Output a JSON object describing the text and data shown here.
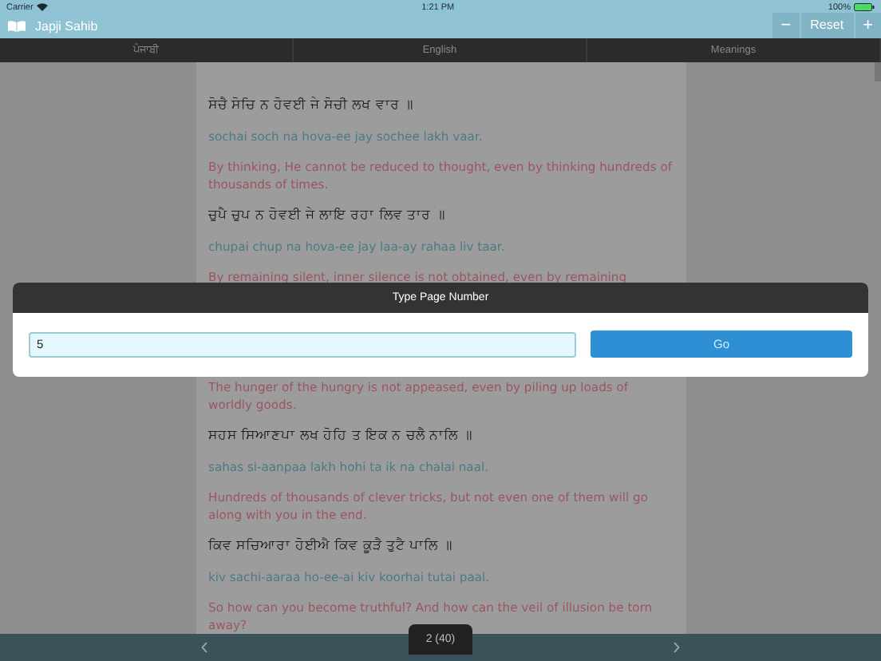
{
  "status_bar": {
    "carrier": "Carrier",
    "time": "1:21 PM",
    "battery": "100%"
  },
  "title_bar": {
    "title": "Japji Sahib",
    "buttons": [
      "−",
      "Reset",
      "+"
    ]
  },
  "tabs": [
    {
      "label": "ਪੰਜਾਬੀ",
      "selected": false
    },
    {
      "label": "English",
      "selected": false
    },
    {
      "label": "Meanings",
      "selected": false
    }
  ],
  "content_top": [
    {
      "kind": "gurmukhi",
      "text": "ਸੋਚੈ ਸੋਚਿ ਨ ਹੋਵਈ ਜੇ ਸੋਚੀ ਲਖ ਵਾਰ ॥"
    },
    {
      "kind": "transliteration",
      "text": "sochai soch na hova-ee jay sochee lakh vaar."
    },
    {
      "kind": "translation",
      "text": "By thinking, He cannot be reduced to thought, even by thinking hundreds of thousands of times."
    },
    {
      "kind": "gurmukhi",
      "text": "ਚੁਪੈ ਚੁਪ ਨ ਹੋਵਈ ਜੇ ਲਾਇ ਰਹਾ ਲਿਵ ਤਾਰ ॥"
    },
    {
      "kind": "transliteration",
      "text": "chupai chup na hova-ee jay laa-ay rahaa liv taar."
    },
    {
      "kind": "translation",
      "text": "By remaining silent, inner silence is not obtained, even by remaining"
    }
  ],
  "content_bottom": [
    {
      "kind": "translation",
      "text": "The hunger of the hungry is not appeased, even by piling up loads of worldly goods."
    },
    {
      "kind": "gurmukhi",
      "text": "ਸਹਸ ਸਿਆਣਪਾ ਲਖ ਹੋਹਿ ਤ ਇਕ ਨ ਚਲੈ ਨਾਲਿ ॥"
    },
    {
      "kind": "transliteration",
      "text": "sahas si-aanpaa lakh hohi ta ik na chalai naal."
    },
    {
      "kind": "translation",
      "text": "Hundreds of thousands of clever tricks, but not even one of them will go along with you in the end."
    },
    {
      "kind": "gurmukhi",
      "text": "ਕਿਵ ਸਚਿਆਰਾ ਹੋਈਐ ਕਿਵ ਕੂੜੈ ਤੁਟੈ ਪਾਲਿ ॥"
    },
    {
      "kind": "transliteration",
      "text": "kiv sachi-aaraa ho-ee-ai kiv koorhai tutai paal."
    },
    {
      "kind": "translation",
      "text": "So how can you become truthful? And how can the veil of illusion be torn away?"
    }
  ],
  "dialog": {
    "title": "Type Page Number",
    "value": "5",
    "button": "Go"
  },
  "pager": {
    "page": "2 (40)"
  }
}
